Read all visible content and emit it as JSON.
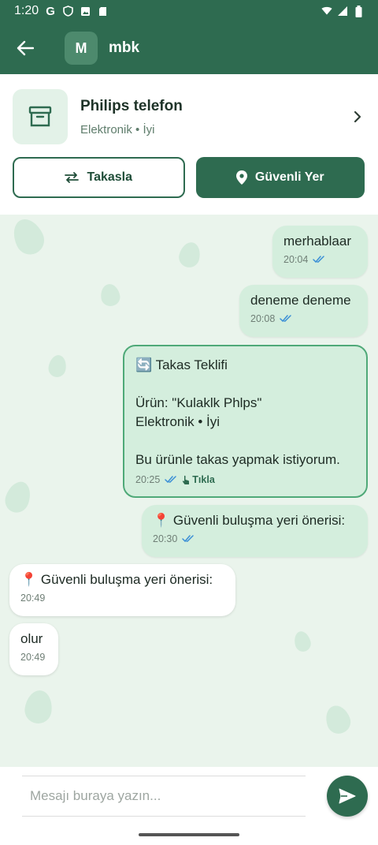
{
  "status_bar": {
    "time": "1:20",
    "icons": [
      "google-icon",
      "shield-icon",
      "image-icon",
      "sd-card-icon",
      "wifi-icon",
      "signal-icon",
      "battery-icon"
    ]
  },
  "header": {
    "avatar_letter": "M",
    "contact_name": "mbk"
  },
  "product": {
    "title": "Philips telefon",
    "subtitle": "Elektronik • İyi"
  },
  "actions": {
    "swap_label": "Takasla",
    "safe_place_label": "Güvenli Yer"
  },
  "messages": [
    {
      "direction": "out",
      "text": "merhablaar",
      "time": "20:04",
      "read": true
    },
    {
      "direction": "out",
      "text": "deneme deneme",
      "time": "20:08",
      "read": true
    },
    {
      "direction": "out",
      "type": "offer",
      "title": "🔄 Takas Teklifi",
      "product_line": "Ürün: \"Kulaklk Phlps\"",
      "detail_line": "Elektronik • İyi",
      "body": "Bu ürünle takas yapmak istiyorum.",
      "time": "20:25",
      "read": true,
      "action_label": "Tıkla"
    },
    {
      "direction": "out",
      "text": "📍 Güvenli buluşma yeri önerisi:",
      "time": "20:30",
      "read": true
    },
    {
      "direction": "in",
      "text": "📍 Güvenli buluşma yeri önerisi:",
      "time": "20:49"
    },
    {
      "direction": "in",
      "text": "olur",
      "time": "20:49"
    }
  ],
  "composer": {
    "placeholder": "Mesajı buraya yazın..."
  },
  "colors": {
    "primary": "#2e6b50",
    "outgoing_bubble": "#d4eedd",
    "incoming_bubble": "#ffffff",
    "chat_background": "#eaf4ec",
    "read_ticks": "#3b8fd6"
  }
}
